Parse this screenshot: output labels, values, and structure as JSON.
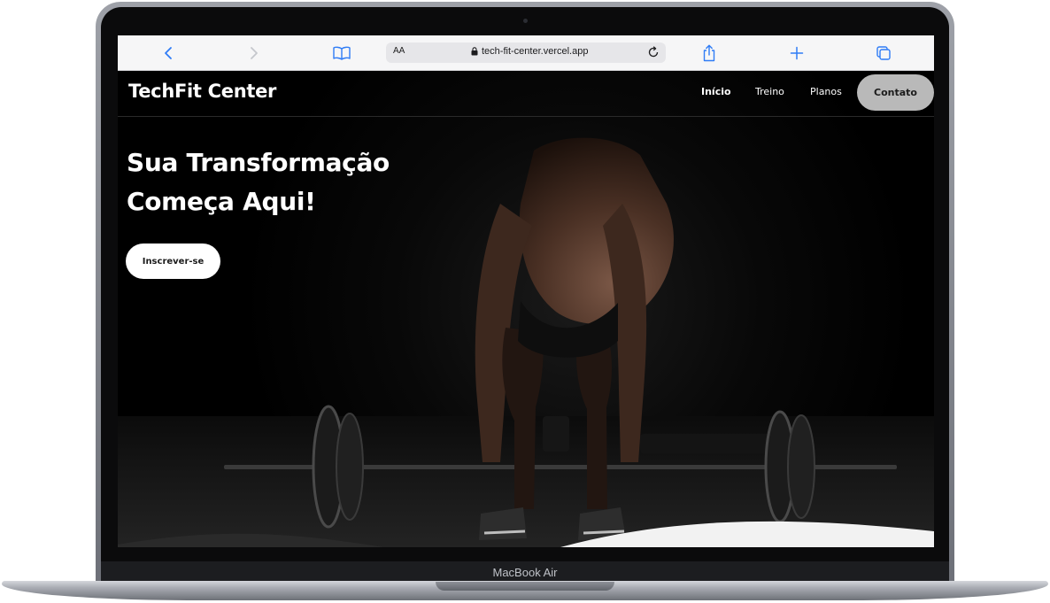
{
  "device": {
    "model_label": "MacBook Air"
  },
  "browser": {
    "text_size_label": "AA",
    "url": "tech-fit-center.vercel.app",
    "icons": {
      "back": "chevron-left-icon",
      "forward": "chevron-right-icon",
      "bookmarks": "book-icon",
      "lock": "lock-icon",
      "reload": "reload-icon",
      "share": "share-icon",
      "new_tab": "plus-icon",
      "tabs": "tabs-icon"
    },
    "accent_color": "#2f7cf6"
  },
  "site": {
    "brand": "TechFit Center",
    "nav": {
      "home": "Início",
      "training": "Treino",
      "plans": "Planos",
      "contact": "Contato"
    },
    "hero": {
      "title_line1": "Sua Transformação",
      "title_line2": "Começa Aqui!",
      "cta": "Inscrever-se"
    },
    "colors": {
      "background": "#000000",
      "text": "#ffffff",
      "contact_button": "#b9b9b9",
      "cta_button": "#ffffff"
    }
  }
}
